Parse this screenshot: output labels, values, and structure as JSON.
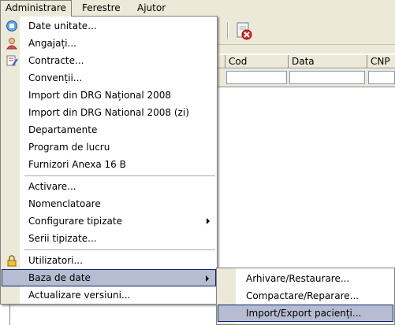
{
  "menubar": {
    "items": [
      "Administrare",
      "Ferestre",
      "Ajutor"
    ]
  },
  "grid": {
    "columns": [
      "Cod",
      "Data",
      "CNP"
    ]
  },
  "menu": {
    "items": [
      "Date unitate...",
      "Angajați...",
      "Contracte...",
      "Convenții...",
      "Import din DRG Național 2008",
      "Import din DRG National 2008 (zi)",
      "Departamente",
      "Program de lucru",
      "Furnizori Anexa 16 B",
      "Activare...",
      "Nomenclatoare",
      "Configurare tipizate",
      "Serii tipizate...",
      "Utilizatori...",
      "Baza de date",
      "Actualizare versiuni..."
    ]
  },
  "submenu": {
    "items": [
      "Arhivare/Restaurare...",
      "Compactare/Reparare...",
      "Import/Export pacienți..."
    ]
  }
}
